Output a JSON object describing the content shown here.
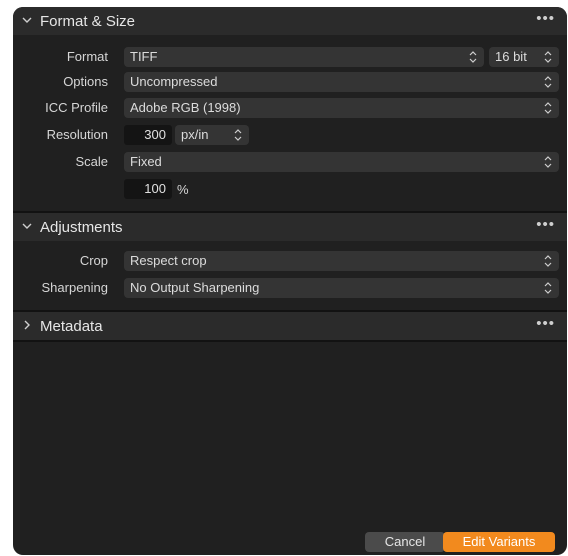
{
  "sections": {
    "format_size": {
      "title": "Format & Size",
      "format_label": "Format",
      "format_value": "TIFF",
      "bitdepth_value": "16 bit",
      "options_label": "Options",
      "options_value": "Uncompressed",
      "icc_label": "ICC Profile",
      "icc_value": "Adobe RGB (1998)",
      "resolution_label": "Resolution",
      "resolution_value": "300",
      "resolution_unit": "px/in",
      "scale_label": "Scale",
      "scale_value": "Fixed",
      "scale_percent": "100",
      "percent_sign": "%"
    },
    "adjustments": {
      "title": "Adjustments",
      "crop_label": "Crop",
      "crop_value": "Respect crop",
      "sharpening_label": "Sharpening",
      "sharpening_value": "No Output Sharpening"
    },
    "metadata": {
      "title": "Metadata"
    }
  },
  "icons": {
    "more": "•••",
    "chevron_down": "chevron-down-icon",
    "chevron_right": "chevron-right-icon",
    "updown": "updown-arrows-icon"
  },
  "footer": {
    "cancel_label": "Cancel",
    "primary_label": "Edit Variants"
  },
  "colors": {
    "panel_bg": "#202020",
    "header_bg": "#2b2b2b",
    "control_bg": "#343434",
    "field_bg": "#141414",
    "accent": "#f28a1e"
  }
}
